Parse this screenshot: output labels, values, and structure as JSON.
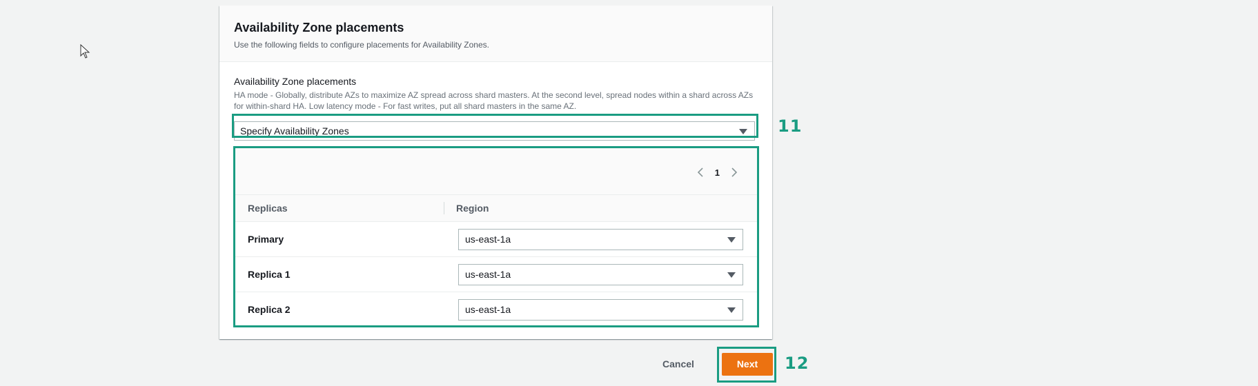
{
  "section": {
    "title": "Availability Zone placements",
    "description": "Use the following fields to configure placements for Availability Zones."
  },
  "placement_field": {
    "label": "Availability Zone placements",
    "description": "HA mode - Globally, distribute AZs to maximize AZ spread across shard masters. At the second level, spread nodes within a shard across AZs for within-shard HA. Low latency mode - For fast writes, put all shard masters in the same AZ.",
    "selected_value": "Specify Availability Zones"
  },
  "pagination": {
    "current_page": "1",
    "prev_icon": "chevron-left-icon",
    "next_icon": "chevron-right-icon"
  },
  "table": {
    "columns": [
      "Replicas",
      "Region"
    ],
    "rows": [
      {
        "replica": "Primary",
        "region": "us-east-1a"
      },
      {
        "replica": "Replica 1",
        "region": "us-east-1a"
      },
      {
        "replica": "Replica 2",
        "region": "us-east-1a"
      }
    ]
  },
  "actions": {
    "cancel_label": "Cancel",
    "next_label": "Next"
  },
  "annotations": {
    "step_11": "11",
    "step_12": "12"
  },
  "colors": {
    "accent_orange": "#ec7211",
    "highlight_teal": "#1a9c82"
  }
}
